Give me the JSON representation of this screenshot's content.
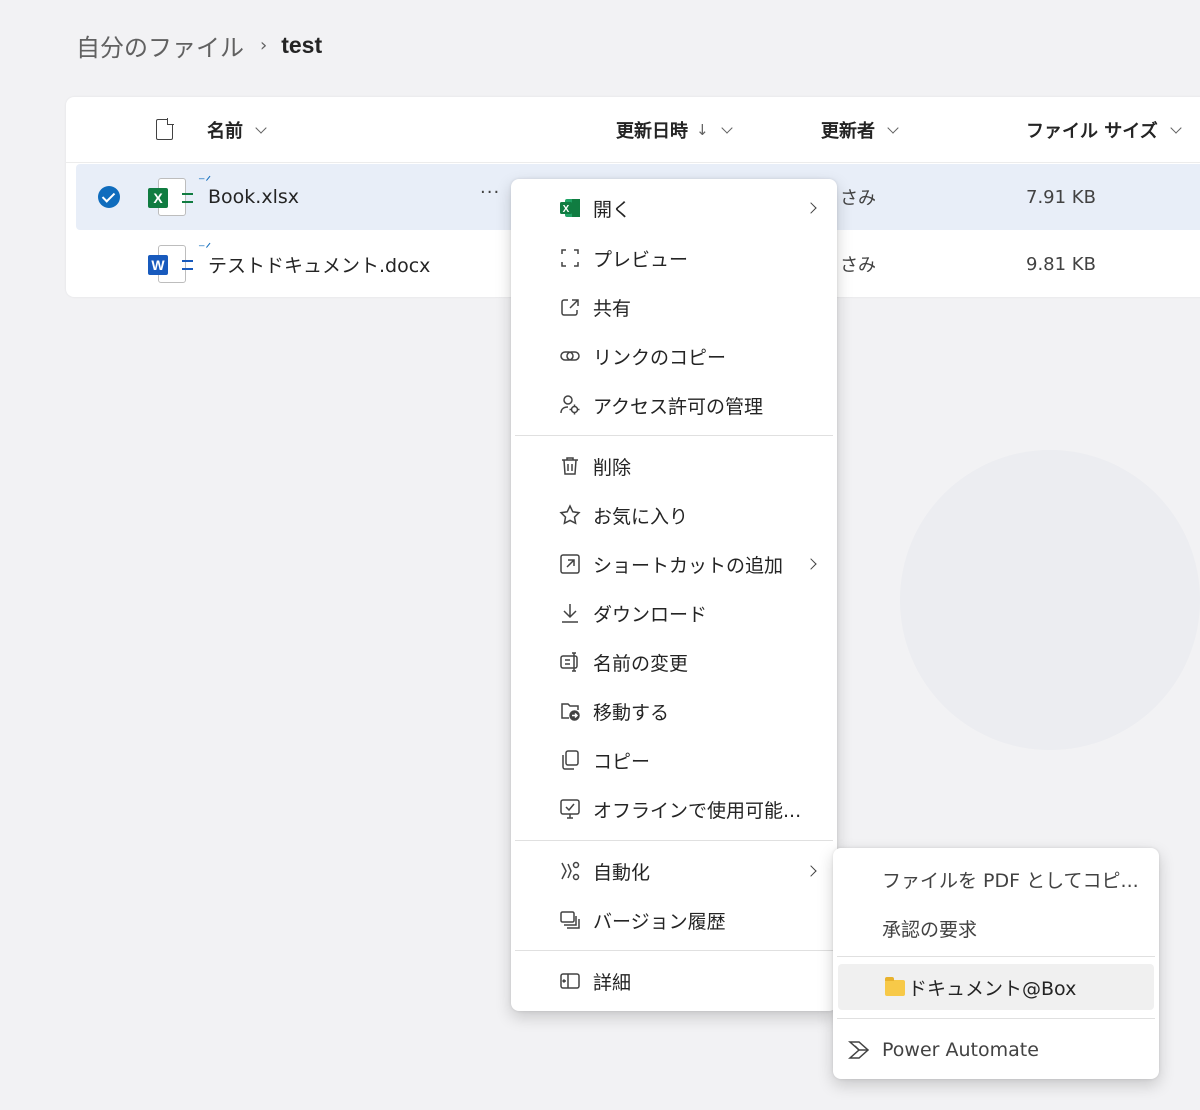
{
  "breadcrumb": {
    "root": "自分のファイル",
    "separator": "›",
    "current": "test"
  },
  "columns": {
    "name": "名前",
    "modified": "更新日時",
    "sort_arrow": "↓",
    "modified_by": "更新者",
    "file_size": "ファイル サイズ"
  },
  "files": [
    {
      "name": "Book.xlsx",
      "type": "xlsx",
      "icon": "excel-icon",
      "modified_by": "さみ",
      "size": "7.91 KB",
      "selected": true,
      "more": "···"
    },
    {
      "name": "テストドキュメント.docx",
      "type": "docx",
      "icon": "word-icon",
      "modified_by": "さみ",
      "size": "9.81 KB",
      "selected": false
    }
  ],
  "context_menu": {
    "items": [
      {
        "label": "開く",
        "icon": "excel-icon",
        "submenu": true
      },
      {
        "label": "プレビュー",
        "icon": "preview-icon"
      },
      {
        "label": "共有",
        "icon": "share-icon"
      },
      {
        "label": "リンクのコピー",
        "icon": "link-icon"
      },
      {
        "label": "アクセス許可の管理",
        "icon": "person-settings-icon"
      },
      {
        "label": "削除",
        "icon": "trash-icon"
      },
      {
        "label": "お気に入り",
        "icon": "star-icon"
      },
      {
        "label": "ショートカットの追加",
        "icon": "shortcut-icon",
        "submenu": true
      },
      {
        "label": "ダウンロード",
        "icon": "download-icon"
      },
      {
        "label": "名前の変更",
        "icon": "rename-icon"
      },
      {
        "label": "移動する",
        "icon": "move-folder-icon"
      },
      {
        "label": "コピー",
        "icon": "copy-icon"
      },
      {
        "label": "オフラインで使用可能...",
        "icon": "offline-icon"
      },
      {
        "label": "自動化",
        "icon": "automate-icon",
        "submenu": true
      },
      {
        "label": "バージョン履歴",
        "icon": "version-history-icon"
      },
      {
        "label": "詳細",
        "icon": "details-icon"
      }
    ]
  },
  "automate_submenu": {
    "items": [
      {
        "label": "ファイルを PDF としてコピ..."
      },
      {
        "label": "承認の要求"
      },
      {
        "label": "ドキュメント@Box",
        "icon": "folder-icon"
      },
      {
        "label": "Power Automate",
        "icon": "power-automate-icon",
        "submenu": true
      }
    ]
  },
  "colors": {
    "accent": "#0f6cbd",
    "excel": "#107c41",
    "word": "#185abd",
    "selected_row": "#e8eef8"
  }
}
